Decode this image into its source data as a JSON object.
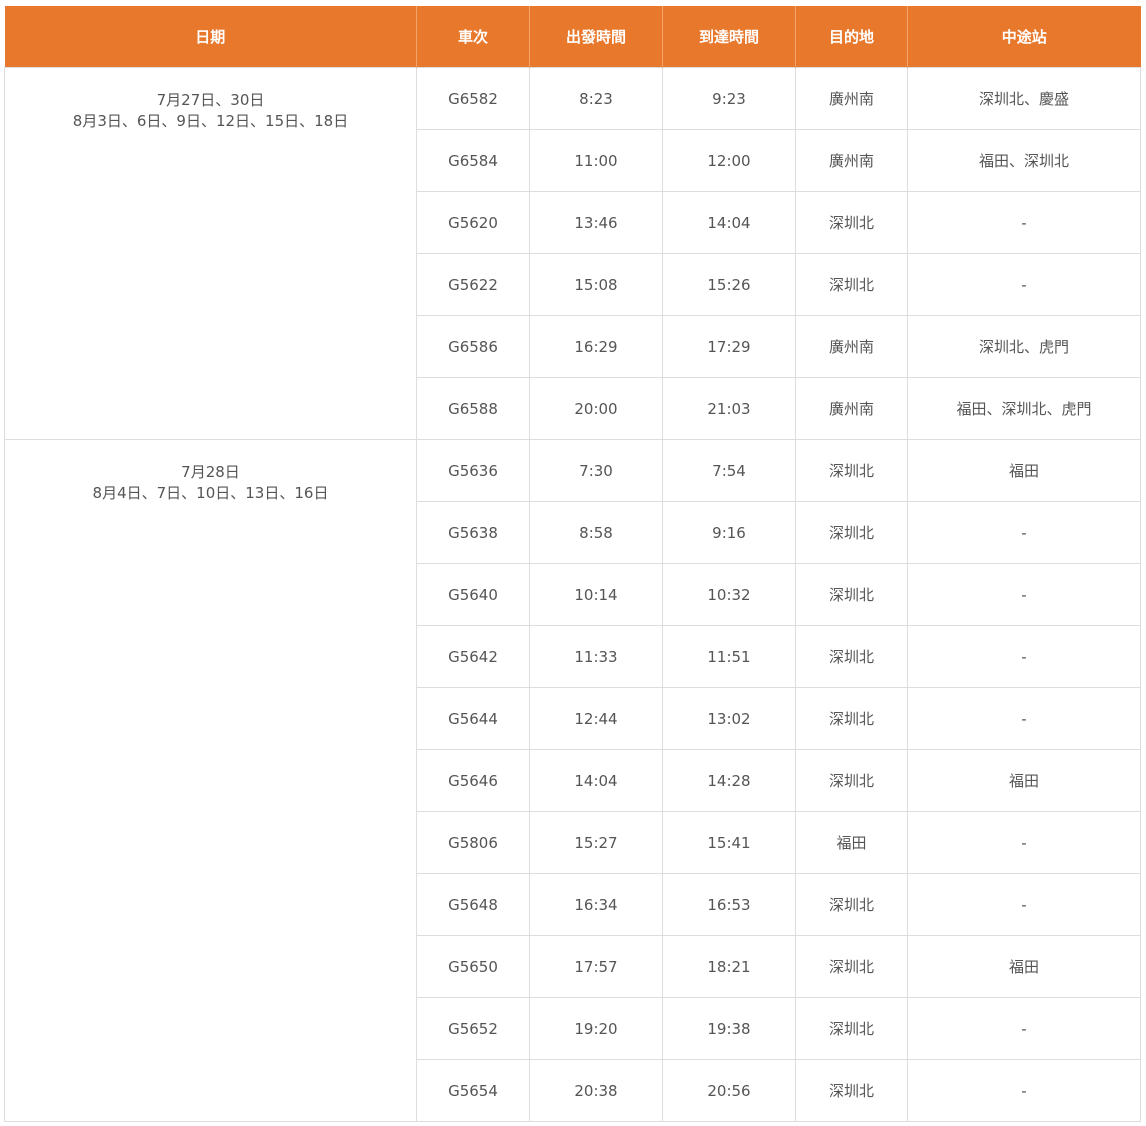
{
  "headers": {
    "date": "日期",
    "train": "車次",
    "departure": "出發時間",
    "arrival": "到達時間",
    "destination": "目的地",
    "via": "中途站"
  },
  "groups": [
    {
      "date_line1": "7月27日、30日",
      "date_line2": "8月3日、6日、9日、12日、15日、18日",
      "rows": [
        {
          "train": "G6582",
          "dep": "8:23",
          "arr": "9:23",
          "dest": "廣州南",
          "via": "深圳北、慶盛"
        },
        {
          "train": "G6584",
          "dep": "11:00",
          "arr": "12:00",
          "dest": "廣州南",
          "via": "福田、深圳北"
        },
        {
          "train": "G5620",
          "dep": "13:46",
          "arr": "14:04",
          "dest": "深圳北",
          "via": "-"
        },
        {
          "train": "G5622",
          "dep": "15:08",
          "arr": "15:26",
          "dest": "深圳北",
          "via": "-"
        },
        {
          "train": "G6586",
          "dep": "16:29",
          "arr": "17:29",
          "dest": "廣州南",
          "via": "深圳北、虎門"
        },
        {
          "train": "G6588",
          "dep": "20:00",
          "arr": "21:03",
          "dest": "廣州南",
          "via": "福田、深圳北、虎門"
        }
      ]
    },
    {
      "date_line1": "7月28日",
      "date_line2": "8月4日、7日、10日、13日、16日",
      "rows": [
        {
          "train": "G5636",
          "dep": "7:30",
          "arr": "7:54",
          "dest": "深圳北",
          "via": "福田"
        },
        {
          "train": "G5638",
          "dep": "8:58",
          "arr": "9:16",
          "dest": "深圳北",
          "via": "-"
        },
        {
          "train": "G5640",
          "dep": "10:14",
          "arr": "10:32",
          "dest": "深圳北",
          "via": "-"
        },
        {
          "train": "G5642",
          "dep": "11:33",
          "arr": "11:51",
          "dest": "深圳北",
          "via": "-"
        },
        {
          "train": "G5644",
          "dep": "12:44",
          "arr": "13:02",
          "dest": "深圳北",
          "via": "-"
        },
        {
          "train": "G5646",
          "dep": "14:04",
          "arr": "14:28",
          "dest": "深圳北",
          "via": "福田"
        },
        {
          "train": "G5806",
          "dep": "15:27",
          "arr": "15:41",
          "dest": "福田",
          "via": "-"
        },
        {
          "train": "G5648",
          "dep": "16:34",
          "arr": "16:53",
          "dest": "深圳北",
          "via": "-"
        },
        {
          "train": "G5650",
          "dep": "17:57",
          "arr": "18:21",
          "dest": "深圳北",
          "via": "福田"
        },
        {
          "train": "G5652",
          "dep": "19:20",
          "arr": "19:38",
          "dest": "深圳北",
          "via": "-"
        },
        {
          "train": "G5654",
          "dep": "20:38",
          "arr": "20:56",
          "dest": "深圳北",
          "via": "-"
        }
      ]
    }
  ]
}
